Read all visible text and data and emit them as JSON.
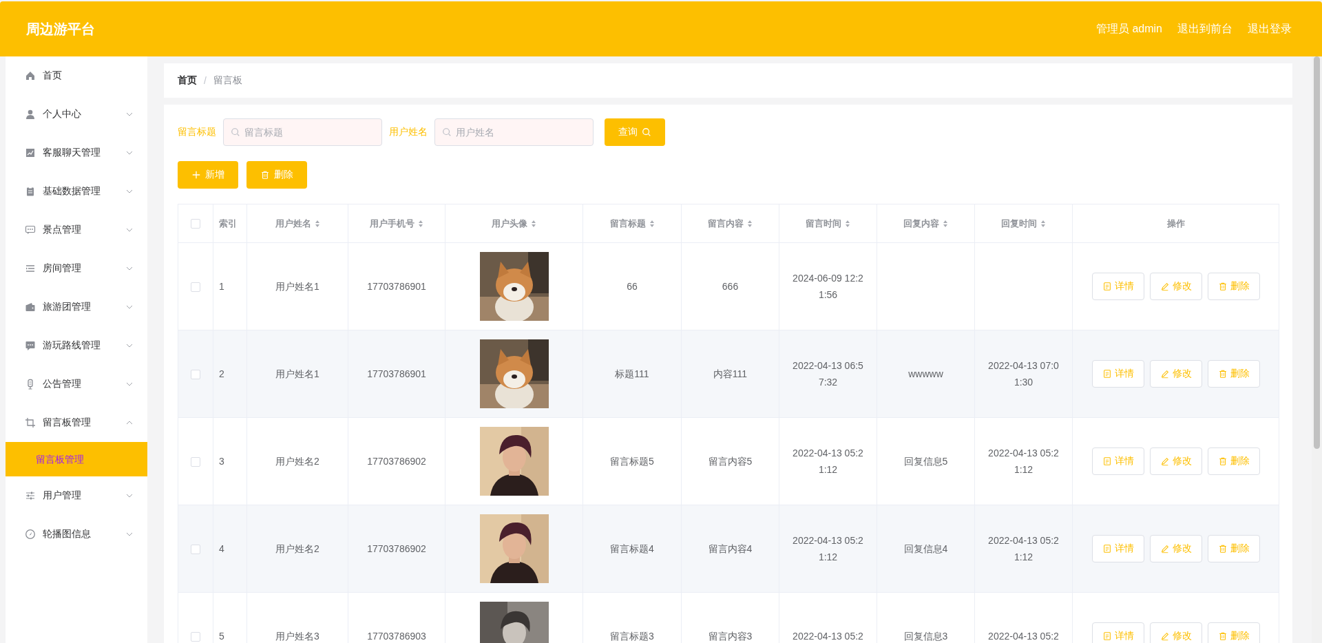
{
  "header": {
    "title": "周边游平台",
    "links": [
      "管理员 admin",
      "退出到前台",
      "退出登录"
    ]
  },
  "sidebar": {
    "items": [
      {
        "label": "首页"
      },
      {
        "label": "个人中心",
        "expanded": false
      },
      {
        "label": "客服聊天管理",
        "expanded": false
      },
      {
        "label": "基础数据管理",
        "expanded": false
      },
      {
        "label": "景点管理",
        "expanded": false
      },
      {
        "label": "房间管理",
        "expanded": false
      },
      {
        "label": "旅游团管理",
        "expanded": false
      },
      {
        "label": "游玩路线管理",
        "expanded": false
      },
      {
        "label": "公告管理",
        "expanded": false
      },
      {
        "label": "留言板管理",
        "expanded": true,
        "children": [
          {
            "label": "留言板管理",
            "selected": true
          }
        ]
      },
      {
        "label": "用户管理",
        "expanded": false
      },
      {
        "label": "轮播图信息",
        "expanded": false
      }
    ]
  },
  "breadcrumb": {
    "separator": "/",
    "items": [
      "首页",
      "留言板"
    ]
  },
  "search": {
    "fields": [
      {
        "label": "留言标题",
        "placeholder": "留言标题"
      },
      {
        "label": "用户姓名",
        "placeholder": "用户姓名"
      }
    ],
    "button": "查询"
  },
  "toolbar": [
    {
      "kind": "add",
      "label": "新增"
    },
    {
      "kind": "delete",
      "label": "删除"
    }
  ],
  "table": {
    "header_checked": false,
    "columns": [
      {
        "label": "索引",
        "sortable": false
      },
      {
        "label": "用户姓名",
        "sortable": true
      },
      {
        "label": "用户手机号",
        "sortable": true
      },
      {
        "label": "用户头像",
        "sortable": true
      },
      {
        "label": "留言标题",
        "sortable": true
      },
      {
        "label": "留言内容",
        "sortable": true
      },
      {
        "label": "留言时间",
        "sortable": true
      },
      {
        "label": "回复内容",
        "sortable": true
      },
      {
        "label": "回复时间",
        "sortable": true
      },
      {
        "label": "操作",
        "sortable": false
      }
    ],
    "rows": [
      {
        "checked": false,
        "index": "1",
        "name": "用户姓名1",
        "phone": "17703786901",
        "title": "66",
        "content": "666",
        "time": "2024-06-09 12:21:56",
        "reply": "",
        "reply_time": "",
        "actions": [
          {
            "kind": "detail",
            "label": "详情"
          },
          {
            "kind": "edit",
            "label": "修改"
          },
          {
            "kind": "delete",
            "label": "删除"
          }
        ]
      },
      {
        "checked": false,
        "index": "2",
        "name": "用户姓名1",
        "phone": "17703786901",
        "title": "标题111",
        "content": "内容111",
        "time": "2022-04-13 06:57:32",
        "reply": "wwwww",
        "reply_time": "2022-04-13 07:01:30",
        "actions": [
          {
            "kind": "detail",
            "label": "详情"
          },
          {
            "kind": "edit",
            "label": "修改"
          },
          {
            "kind": "delete",
            "label": "删除"
          }
        ]
      },
      {
        "checked": false,
        "index": "3",
        "name": "用户姓名2",
        "phone": "17703786902",
        "title": "留言标题5",
        "content": "留言内容5",
        "time": "2022-04-13 05:21:12",
        "reply": "回复信息5",
        "reply_time": "2022-04-13 05:21:12",
        "actions": [
          {
            "kind": "detail",
            "label": "详情"
          },
          {
            "kind": "edit",
            "label": "修改"
          },
          {
            "kind": "delete",
            "label": "删除"
          }
        ]
      },
      {
        "checked": false,
        "index": "4",
        "name": "用户姓名2",
        "phone": "17703786902",
        "title": "留言标题4",
        "content": "留言内容4",
        "time": "2022-04-13 05:21:12",
        "reply": "回复信息4",
        "reply_time": "2022-04-13 05:21:12",
        "actions": [
          {
            "kind": "detail",
            "label": "详情"
          },
          {
            "kind": "edit",
            "label": "修改"
          },
          {
            "kind": "delete",
            "label": "删除"
          }
        ]
      },
      {
        "checked": false,
        "index": "5",
        "name": "用户姓名3",
        "phone": "17703786903",
        "title": "留言标题3",
        "content": "留言内容3",
        "time": "2022-04-13 05:2",
        "reply": "回复信息3",
        "reply_time": "2022-04-13 05:2",
        "actions": [
          {
            "kind": "detail",
            "label": "详情"
          },
          {
            "kind": "edit",
            "label": "修改"
          },
          {
            "kind": "delete",
            "label": "删除"
          }
        ]
      }
    ]
  }
}
